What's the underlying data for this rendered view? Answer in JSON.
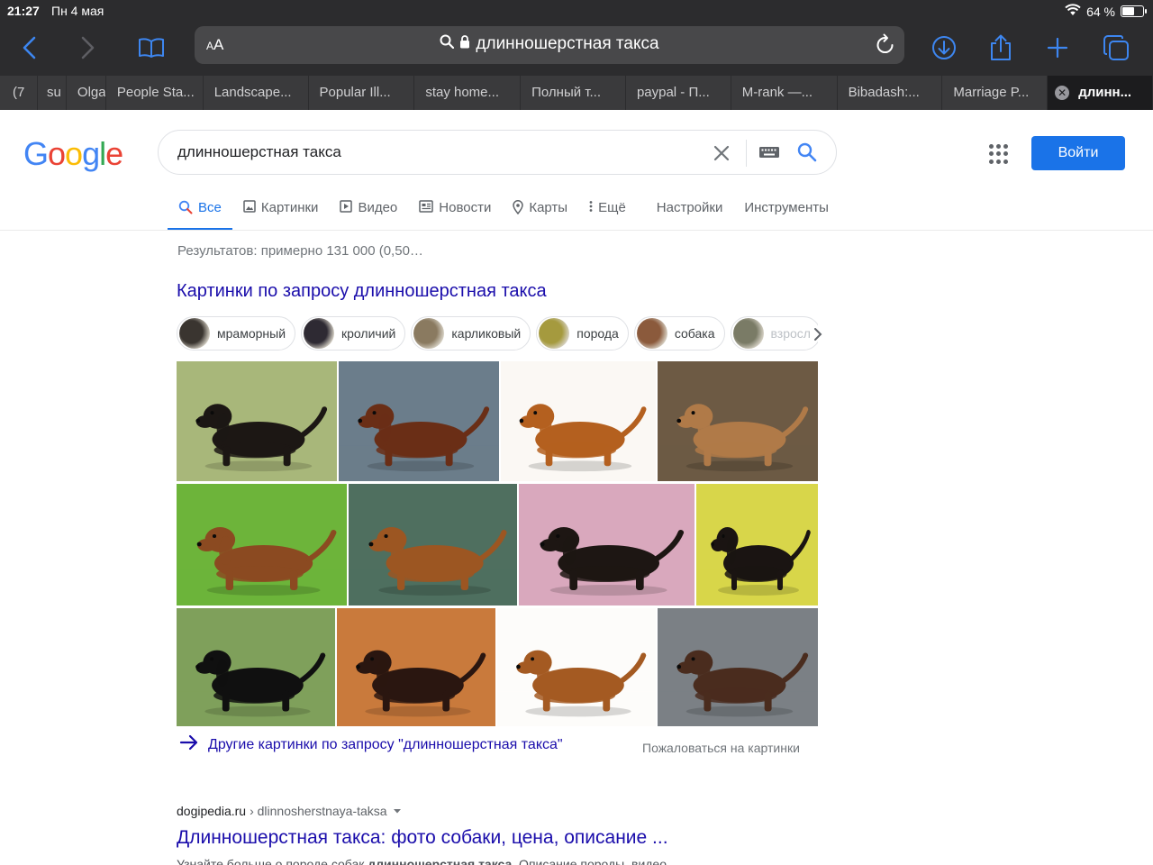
{
  "status_bar": {
    "time": "21:27",
    "date": "Пн 4 мая",
    "battery": "64 %",
    "battery_level": 0.64
  },
  "safari": {
    "text_size_button": "AA",
    "address": "длинношерстная такса",
    "tabs": [
      {
        "label": "(7"
      },
      {
        "label": "su"
      },
      {
        "label": "Olga"
      },
      {
        "label": "People Sta..."
      },
      {
        "label": "Landscape..."
      },
      {
        "label": "Popular Ill..."
      },
      {
        "label": "stay home..."
      },
      {
        "label": "Полный т..."
      },
      {
        "label": "paypal - П..."
      },
      {
        "label": "M-rank —..."
      },
      {
        "label": "Bibadash:..."
      },
      {
        "label": "Marriage P..."
      }
    ],
    "active_tab": "длинн..."
  },
  "google": {
    "logo_letters": [
      "G",
      "o",
      "o",
      "g",
      "l",
      "e"
    ],
    "logo_colors": [
      "#4285F4",
      "#EA4335",
      "#FBBC05",
      "#4285F4",
      "#34A853",
      "#EA4335"
    ],
    "query": "длинношерстная такса",
    "sign_in": "Войти",
    "nav": [
      {
        "label": "Все",
        "icon": "search-icon",
        "active": true
      },
      {
        "label": "Картинки",
        "icon": "image-icon"
      },
      {
        "label": "Видео",
        "icon": "video-icon"
      },
      {
        "label": "Новости",
        "icon": "news-icon"
      },
      {
        "label": "Карты",
        "icon": "map-pin-icon"
      },
      {
        "label": "Ещё",
        "icon": "more-vert-icon"
      },
      {
        "label": "Настройки"
      },
      {
        "label": "Инструменты"
      }
    ],
    "stats": "Результатов: примерно 131 000 (0,50…",
    "images_heading": "Картинки по запросу длинношерстная такса",
    "chips": [
      {
        "label": "мраморный",
        "color": "#3a3530"
      },
      {
        "label": "кроличий",
        "color": "#2e2a33"
      },
      {
        "label": "карликовый",
        "color": "#8a7a60"
      },
      {
        "label": "порода",
        "color": "#a59a3e"
      },
      {
        "label": "собака",
        "color": "#8b5a3c"
      },
      {
        "label": "взросл",
        "color": "#7a7b66"
      }
    ],
    "images": [
      {
        "bg": "#a8b77a",
        "dog": "#1c1714",
        "alt": "dachshund-black"
      },
      {
        "bg": "#6b7d8b",
        "dog": "#6a2e16",
        "alt": "dachshund-red"
      },
      {
        "bg": "#fbf8f4",
        "dog": "#b4601f",
        "alt": "dachshund-lying"
      },
      {
        "bg": "#6d5a44",
        "dog": "#b07a48",
        "alt": "dachshund-light"
      },
      {
        "bg": "#6db43a",
        "dog": "#8b4a21",
        "alt": "dachshund-puppies"
      },
      {
        "bg": "#4f6f5f",
        "dog": "#9c5622",
        "alt": "dachshund-standing"
      },
      {
        "bg": "#d9a8bd",
        "dog": "#1d1613",
        "alt": "dachshund-black-puppies"
      },
      {
        "bg": "#d8d64a",
        "dog": "#1a1412",
        "alt": "dachshund-flowers"
      },
      {
        "bg": "#7fa05b",
        "dog": "#101010",
        "alt": "dachshund-black-grass"
      },
      {
        "bg": "#c97a3c",
        "dog": "#2a1610",
        "alt": "dachshund-orange-bg"
      },
      {
        "bg": "#fdfcfa",
        "dog": "#a45a22",
        "alt": "dachshund-white-bg"
      },
      {
        "bg": "#7b8085",
        "dog": "#4a2c1e",
        "alt": "dachshund-rock"
      }
    ],
    "more_images": "Другие картинки по запросу \"длинношерстная такса\"",
    "report": "Пожаловаться на картинки",
    "result": {
      "domain": "dogipedia.ru",
      "path": "› dlinnosherstnaya-taksa",
      "title": "Длинношерстная такса: фото собаки, цена, описание ...",
      "snippet_before": "Узнайте больше о породе собак ",
      "snippet_bold": "длинношерстная такса",
      "snippet_after": ". Описание породы, видео"
    }
  }
}
